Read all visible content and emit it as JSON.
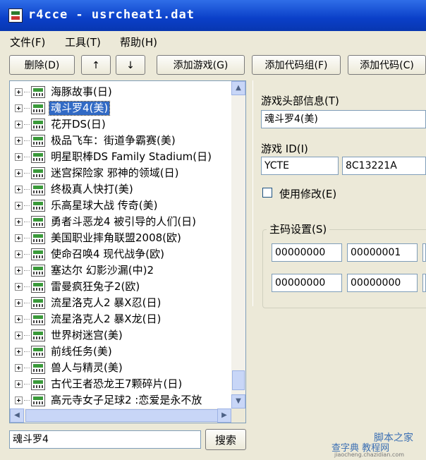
{
  "window": {
    "title": "r4cce - usrcheat1.dat"
  },
  "menu": [
    "文件(F)",
    "工具(T)",
    "帮助(H)"
  ],
  "toolbar": {
    "delete": "删除(D)",
    "up": "↑",
    "down": "↓",
    "add_game": "添加游戏(G)",
    "add_code_group": "添加代码组(F)",
    "add_code": "添加代码(C)"
  },
  "games": [
    "海豚故事(日)",
    "魂斗罗4(美)",
    "花开DS(日)",
    "极品飞车：街道争霸赛(美)",
    "明星职棒DS Family Stadium(日)",
    "迷宫探险家 邪神的领域(日)",
    "终极真人快打(美)",
    "乐高星球大战 传奇(美)",
    "勇者斗恶龙4 被引导的人们(日)",
    "美国职业摔角联盟2008(欧)",
    "使命召唤4 现代战争(欧)",
    "塞达尔 幻影沙漏(中)2",
    "雷曼疯狂兔子2(欧)",
    "流星洛克人2 暴X忍(日)",
    "流星洛克人2 暴X龙(日)",
    "世界树迷宫(美)",
    "前线任务(美)",
    "兽人与精灵(美)",
    "古代王者恐龙王7颗碎片(日)",
    "高元寺女子足球2 :恋爱是永不放"
  ],
  "selected_index": 1,
  "search": {
    "value": "魂斗罗4",
    "button": "搜索"
  },
  "details": {
    "header_label": "游戏头部信息(T)",
    "header_value": "魂斗罗4(美)",
    "id_label": "游戏 ID(I)",
    "id_value": "YCTE",
    "crc_value": "8C13221A",
    "use_modify_label": "使用修改(E)",
    "use_modify_checked": false,
    "master_label": "主码设置(S)",
    "master_codes": [
      "00000000",
      "00000001",
      "00000000",
      "00000000"
    ]
  },
  "watermark": {
    "line1": "脚本之家",
    "line2": "查字典 教程网",
    "line3": "jiaocheng.chazidian.com"
  }
}
